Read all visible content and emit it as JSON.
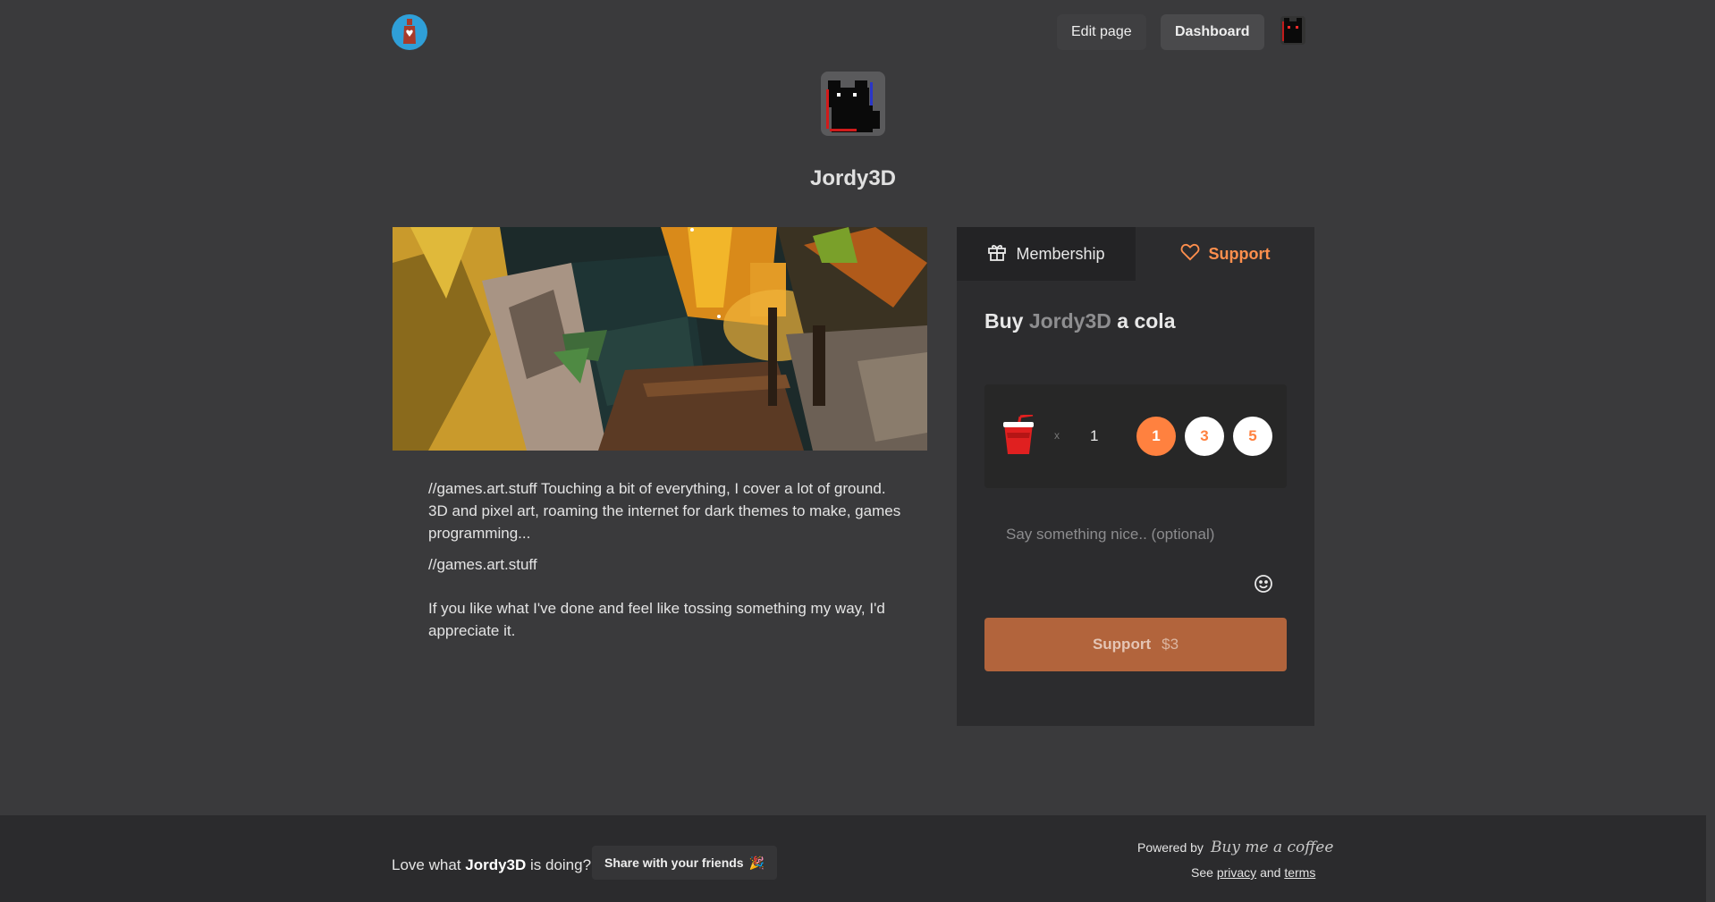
{
  "header": {
    "edit_label": "Edit page",
    "dashboard_label": "Dashboard"
  },
  "profile": {
    "name": "Jordy3D"
  },
  "about": {
    "paragraph1": "//games.art.stuff Touching a bit of everything, I cover a lot of ground. 3D and pixel art, roaming the internet for dark themes to make, games programming...",
    "paragraph2": "//games.art.stuff",
    "paragraph3": "If you like what I've done and feel like tossing something my way, I'd appreciate it."
  },
  "panel": {
    "tabs": [
      {
        "label": "Membership",
        "icon": "gift-icon"
      },
      {
        "label": "Support",
        "icon": "heart-icon",
        "active": true
      }
    ],
    "buy_prefix": "Buy",
    "buy_name": "Jordy3D",
    "buy_suffix": "a cola",
    "times_symbol": "x",
    "quantity": "1",
    "quick_options": [
      "1",
      "3",
      "5"
    ],
    "message_placeholder": "Say something nice.. (optional)",
    "support_label": "Support",
    "support_amount": "$3",
    "accent_color": "#ff813f"
  },
  "footer": {
    "love_prefix": "Love what",
    "love_name": "Jordy3D",
    "love_suffix": "is doing?",
    "share_label": "Share with your friends",
    "share_emoji": "🎉",
    "powered_by": "Powered by",
    "brand": "Buy me a coffee",
    "see": "See",
    "privacy": "privacy",
    "and": "and",
    "terms": "terms"
  }
}
